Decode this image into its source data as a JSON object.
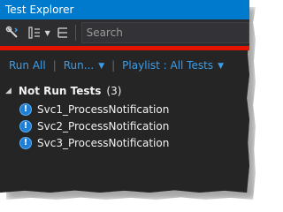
{
  "window": {
    "title": "Test Explorer"
  },
  "toolbar": {
    "search_placeholder": "Search",
    "icons": [
      "run-settings-icon",
      "group-by-icon",
      "dropdown-icon",
      "playlist-icon"
    ]
  },
  "commands": {
    "run_all": "Run All",
    "run": "Run...",
    "playlist": "Playlist : All Tests"
  },
  "group": {
    "label": "Not Run Tests",
    "count": "(3)"
  },
  "tests": [
    {
      "name": "Svc1_ProcessNotification",
      "status_icon": "info-icon"
    },
    {
      "name": "Svc2_ProcessNotification",
      "status_icon": "info-icon"
    },
    {
      "name": "Svc3_ProcessNotification",
      "status_icon": "info-icon"
    }
  ],
  "colors": {
    "titlebar": "#007acc",
    "panel_bg": "#252526",
    "accent_link": "#3d9ee8",
    "highlight_line": "#e51400"
  }
}
